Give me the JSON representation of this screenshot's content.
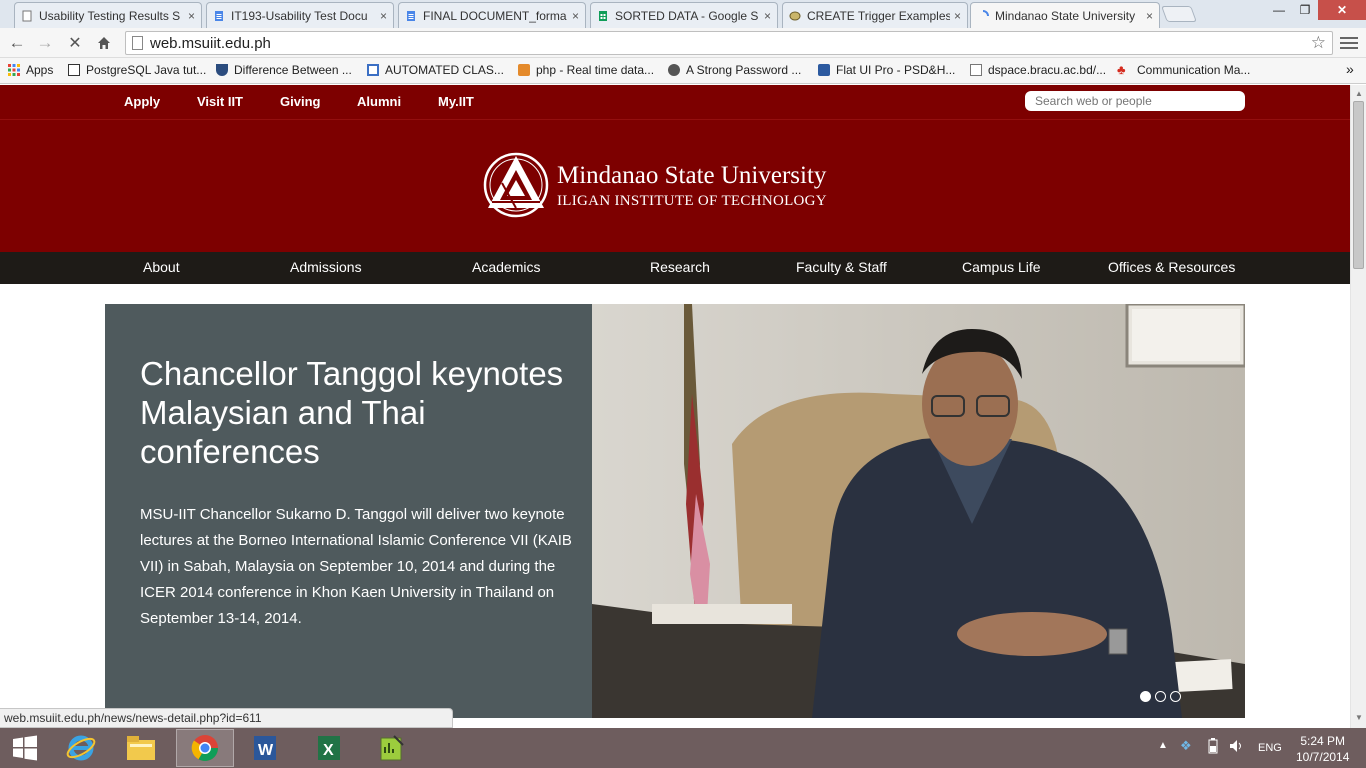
{
  "browser": {
    "tabs": [
      {
        "label": "Usability Testing Results S",
        "active": false
      },
      {
        "label": "IT193-Usability Test Docu",
        "active": false
      },
      {
        "label": "FINAL DOCUMENT_forma",
        "active": false
      },
      {
        "label": "SORTED DATA - Google S",
        "active": false
      },
      {
        "label": "CREATE Trigger Examples",
        "active": false
      },
      {
        "label": "Mindanao State University",
        "active": true
      }
    ],
    "tab_close": "×",
    "url": "web.msuiit.edu.ph",
    "apps_label": "Apps",
    "bookmarks": [
      "PostgreSQL Java tut...",
      "Difference Between ...",
      "AUTOMATED CLAS...",
      "php - Real time data...",
      "A Strong Password ...",
      "Flat UI Pro - PSD&H...",
      "dspace.bracu.ac.bd/...",
      "Communication Ma..."
    ],
    "bookmarks_overflow": "»",
    "status_url": "web.msuiit.edu.ph/news/news-detail.php?id=611"
  },
  "site": {
    "top_links": [
      "Apply",
      "Visit IIT",
      "Giving",
      "Alumni",
      "My.IIT"
    ],
    "search_placeholder": "Search web or people",
    "logo_line1": "Mindanao State University",
    "logo_line2": "ILIGAN INSTITUTE OF TECHNOLOGY",
    "nav": [
      "About",
      "Admissions",
      "Academics",
      "Research",
      "Faculty & Staff",
      "Campus Life",
      "Offices & Resources"
    ],
    "slide": {
      "title": "Chancellor Tanggol keynotes Malaysian and Thai conferences",
      "body": "MSU-IIT Chancellor Sukarno D. Tanggol will deliver two keynote lectures at the Borneo International Islamic Conference VII (KAIB VII) in Sabah, Malaysia on September 10, 2014 and during the ICER 2014 conference in Khon Kaen University in Thailand on September 13-14, 2014.",
      "slide_count": 3,
      "active_slide": 1
    }
  },
  "taskbar": {
    "lang": "ENG",
    "time": "5:24 PM",
    "date": "10/7/2014"
  },
  "colors": {
    "brand_red": "#7d0000",
    "nav_dark": "#1e1b17",
    "slide_panel": "#4f5a5d",
    "taskbar": "#6e5d5e"
  }
}
